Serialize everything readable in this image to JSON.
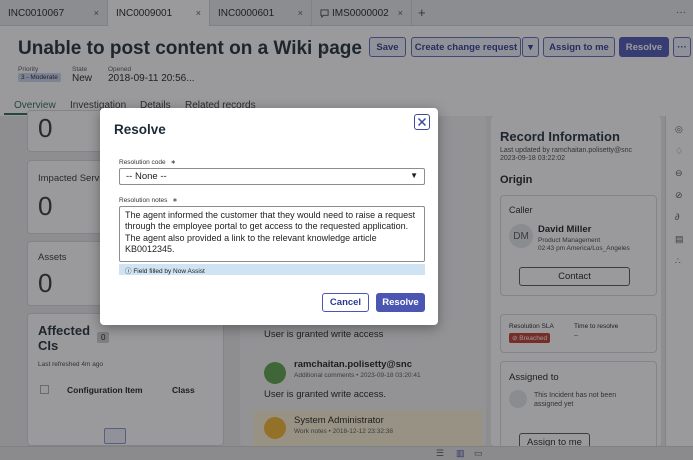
{
  "tabs": [
    {
      "label": "INC0010067",
      "close": "×"
    },
    {
      "label": "INC0009001",
      "close": "×"
    },
    {
      "label": "INC0000601",
      "close": "×"
    },
    {
      "label": "IMS0000002",
      "close": "×"
    }
  ],
  "tabbar": {
    "add": "+",
    "more": "···"
  },
  "record": {
    "title": "Unable to post content on a Wiki page",
    "priority_label": "Priority",
    "priority_value": "3 - Moderate",
    "state_label": "State",
    "state_value": "New",
    "opened_label": "Opened",
    "opened_value": "2018-09-11 20:56..."
  },
  "header_buttons": {
    "save": "Save",
    "create_change": "Create change request",
    "assign_to_me": "Assign to me",
    "resolve": "Resolve",
    "more": "···"
  },
  "subtabs": [
    "Overview",
    "Investigation",
    "Details",
    "Related records"
  ],
  "left_cards": {
    "top_number": "0",
    "impacted_label": "Impacted Servic",
    "impacted_value": "0",
    "assets_label": "Assets",
    "assets_value": "0",
    "affected_title": "Affected CIs",
    "affected_count": "0",
    "last_refreshed": "Last refreshed 4m ago",
    "col_ci": "Configuration Item",
    "col_class": "Class"
  },
  "activity": {
    "msg1": "User is granted write access",
    "user2": "ramchaitan.polisetty@snc",
    "meta2": "Additional comments • 2023-09-18 03:20:41",
    "msg2": "User is granted write access.",
    "user3": "System Administrator",
    "meta3": "Work notes • 2018-12-12 23:32:38"
  },
  "record_info": {
    "title": "Record Information",
    "updated": "Last updated by ramchaitan.polisetty@snc",
    "updated_date": "2023-09-18 03:22:02",
    "origin": "Origin",
    "caller_label": "Caller",
    "caller_initials": "DM",
    "caller_name": "David Miller",
    "caller_dept": "Product Management",
    "caller_time": "02:43 pm America/Los_Angeles",
    "contact": "Contact",
    "sla_label": "Resolution SLA",
    "sla_badge": "Breached",
    "ttr_label": "Time to resolve",
    "ttr_value": "--",
    "assigned_label": "Assigned to",
    "assigned_text": "This Incident has not been assigned yet",
    "assign_btn": "Assign to me"
  },
  "modal": {
    "title": "Resolve",
    "code_label": "Resolution code",
    "required": "∗",
    "code_value": "-- None --",
    "notes_label": "Resolution notes",
    "notes_value": "The agent informed the customer that they would need to raise a request through the employee portal to get access to the requested application. The agent also provided a link to the relevant knowledge article KB0012345.",
    "assist_text": "Field filled by Now Assist",
    "cancel": "Cancel",
    "resolve": "Resolve"
  },
  "colors": {
    "primary": "#4b56b2",
    "breached": "#c0392b",
    "assist_bg": "#cfe3f3"
  }
}
